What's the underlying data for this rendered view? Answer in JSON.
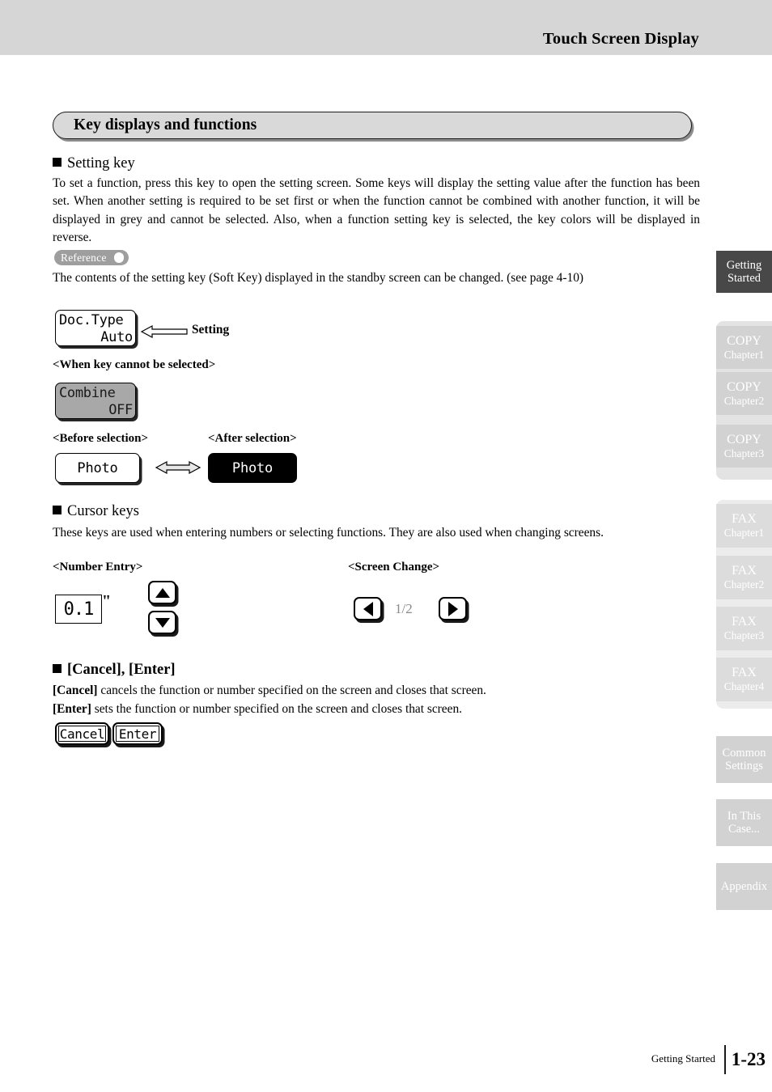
{
  "header": {
    "title": "Touch Screen Display"
  },
  "banner": {
    "title": "Key displays and functions"
  },
  "sections": {
    "setting_key": {
      "heading": "Setting key",
      "body": "To set a function, press this key to open the setting screen. Some keys will display the setting value after the function has been set. When another setting is required to be set first or when the function cannot be combined with another function, it will be displayed in grey and cannot be selected. Also, when a function setting key is selected, the key colors will be displayed in reverse.",
      "reference_badge": "Reference",
      "reference_text": "The contents of the setting key (Soft Key) displayed in the standby screen can be changed. (see page 4-10)",
      "setting_key_sample": {
        "line1": "Doc.Type",
        "line2": "Auto"
      },
      "setting_arrow_label": "Setting",
      "disabled_caption": "<When key cannot be selected>",
      "disabled_key_sample": {
        "line1": "Combine",
        "line2": "OFF"
      },
      "before_caption": "<Before selection>",
      "after_caption": "<After selection>",
      "before_key_label": "Photo",
      "after_key_label": "Photo"
    },
    "cursor_keys": {
      "heading": "Cursor keys",
      "body": "These keys are used when entering numbers or selecting functions. They are also used when changing screens.",
      "number_entry_caption": "<Number Entry>",
      "number_entry_value": "0.1",
      "number_entry_unit": "\"",
      "screen_change_caption": "<Screen Change>",
      "page_indicator": "1/2"
    },
    "cancel_enter": {
      "heading_part1": "[Cancel]",
      "heading_comma": ", ",
      "heading_part2": "[Enter]",
      "cancel_bold": "[Cancel]",
      "cancel_rest": " cancels the function or number specified on the screen and closes that screen.",
      "enter_bold": "[Enter]",
      "enter_rest": " sets the function or number specified on the screen and closes that screen.",
      "cancel_key_label": "Cancel",
      "enter_key_label": "Enter"
    }
  },
  "side_tabs": [
    {
      "line1": "Getting",
      "line2": "Started",
      "active": true
    },
    {
      "line1": "COPY",
      "line2": "Chapter1",
      "active": false
    },
    {
      "line1": "COPY",
      "line2": "Chapter2",
      "active": false
    },
    {
      "line1": "COPY",
      "line2": "Chapter3",
      "active": false
    },
    {
      "line1": "FAX",
      "line2": "Chapter1",
      "active": false
    },
    {
      "line1": "FAX",
      "line2": "Chapter2",
      "active": false
    },
    {
      "line1": "FAX",
      "line2": "Chapter3",
      "active": false
    },
    {
      "line1": "FAX",
      "line2": "Chapter4",
      "active": false
    },
    {
      "line1": "Common",
      "line2": "Settings",
      "active": false
    },
    {
      "line1": "In This",
      "line2": "Case...",
      "active": false
    },
    {
      "line1": "Appendix",
      "line2": "",
      "active": false
    }
  ],
  "footer": {
    "chapter_label": "Getting Started",
    "page_number": "1-23"
  },
  "colors": {
    "header_bar": "#d6d6d6",
    "banner_fill": "#d9d9d9",
    "active_tab": "#484848",
    "copy_tab": "#d2d2d2",
    "fax_tab": "#dcdcdc",
    "plain_tab": "#d2d2d2",
    "reference_badge": "#9e9e9e",
    "disabled_key": "#a8a8a8"
  }
}
